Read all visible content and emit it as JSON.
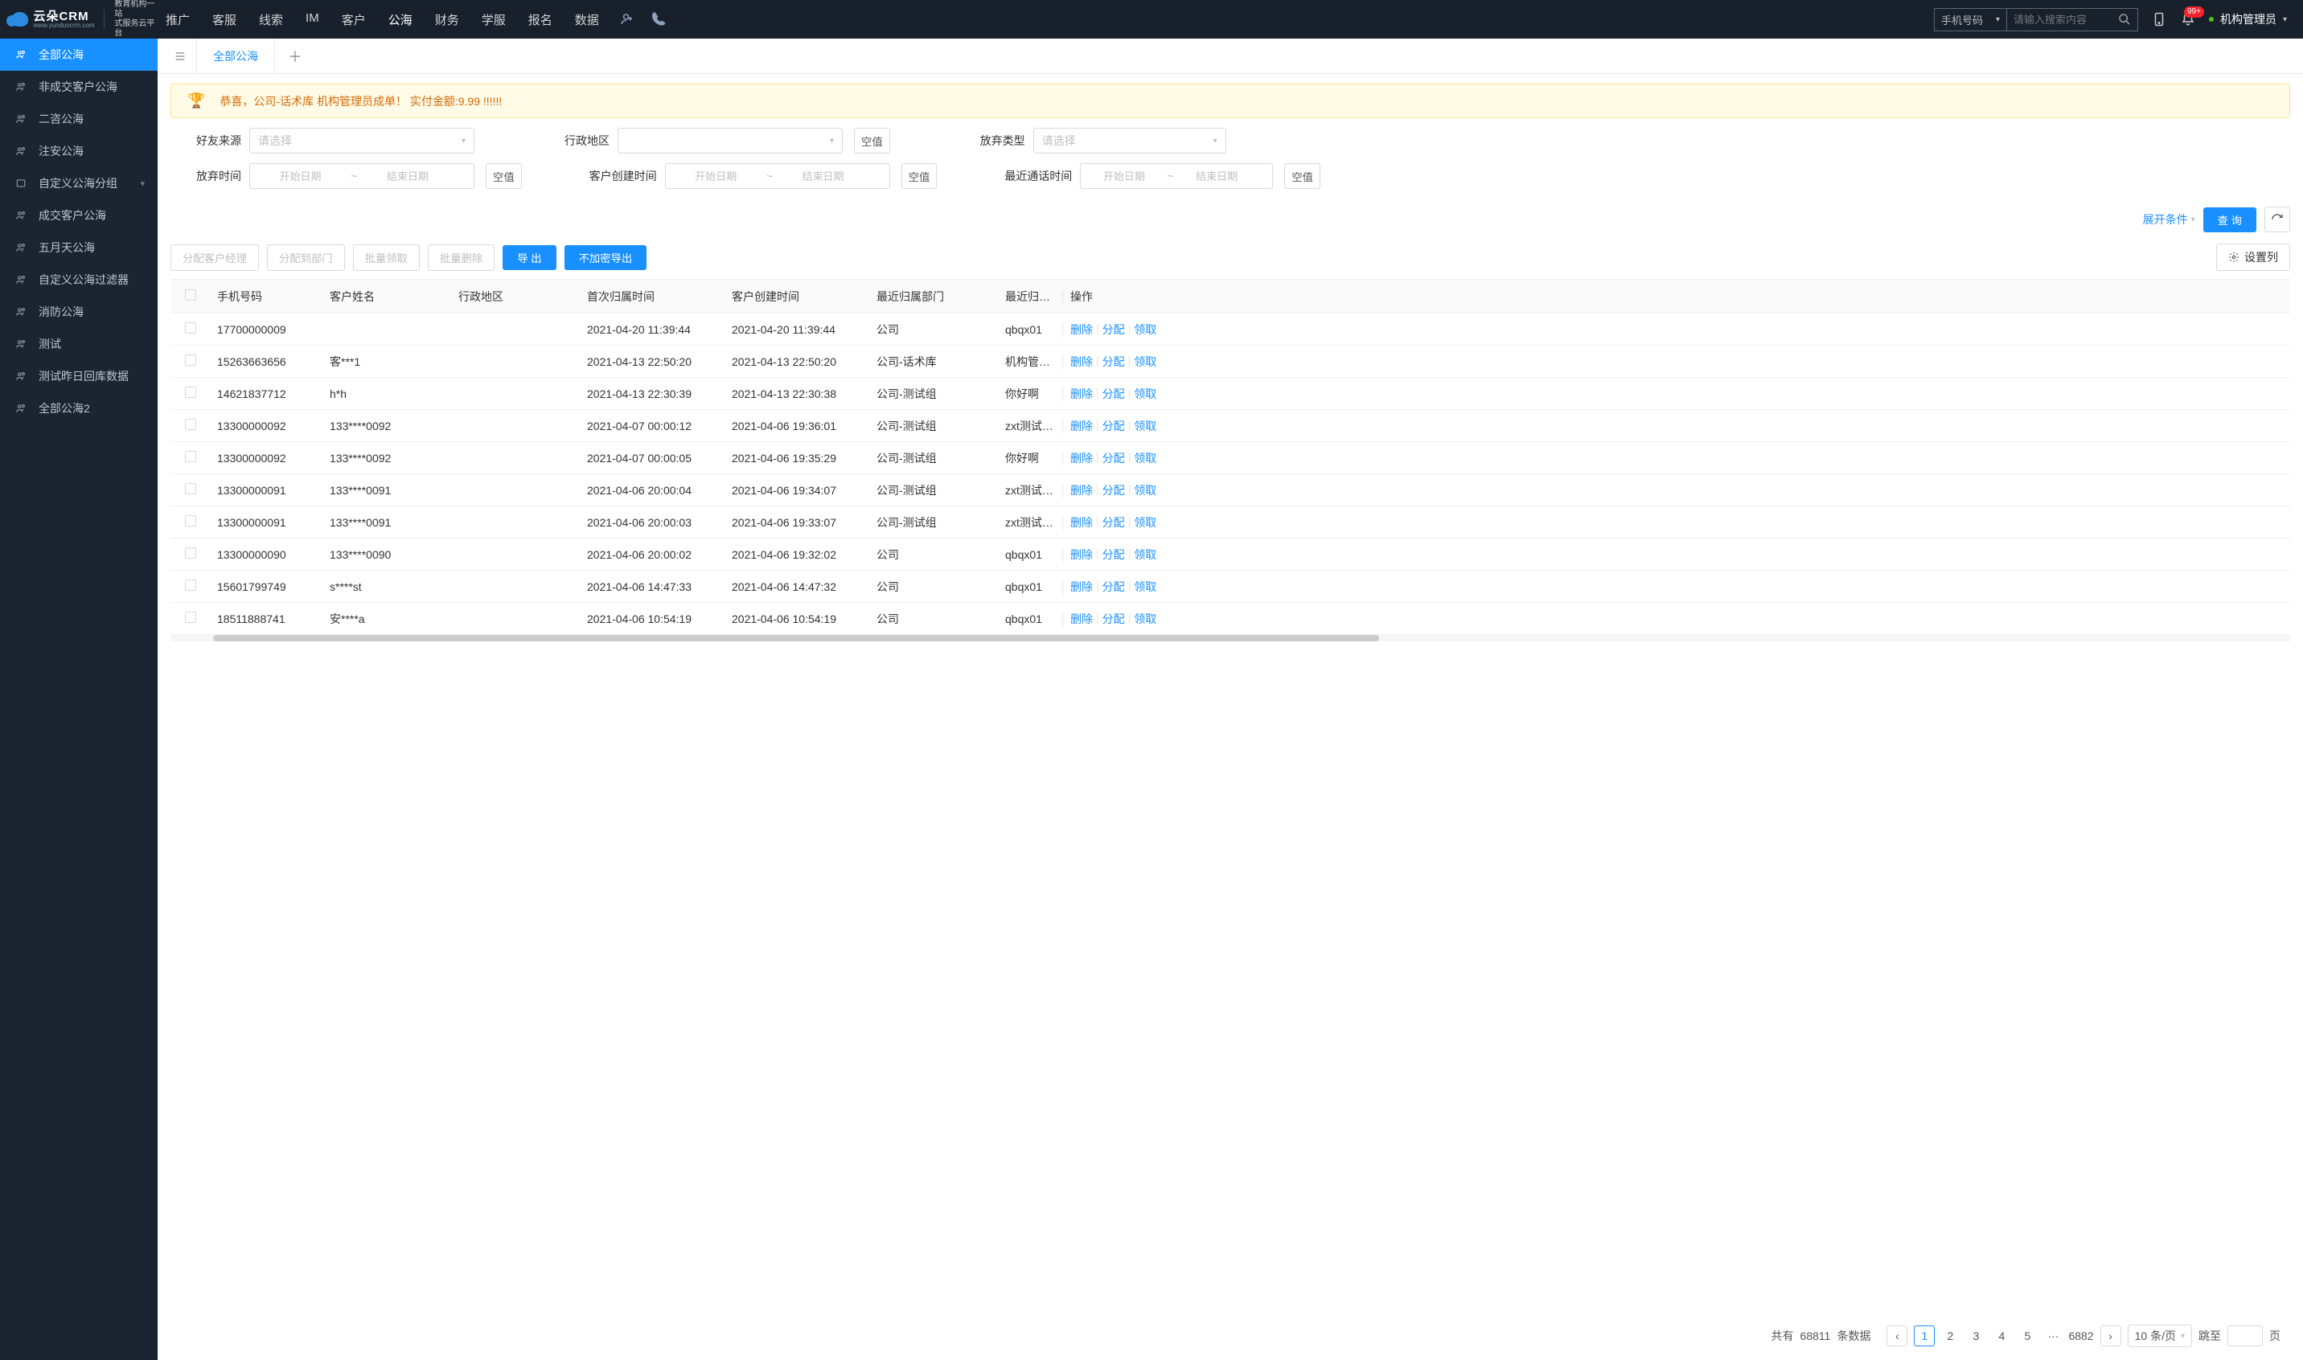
{
  "header": {
    "logo_main": "云朵CRM",
    "logo_sub": "www.yunduocrm.com",
    "logo_tag1": "教育机构一站",
    "logo_tag2": "式服务云平台",
    "nav": [
      "推广",
      "客服",
      "线索",
      "IM",
      "客户",
      "公海",
      "财务",
      "学服",
      "报名",
      "数据"
    ],
    "active_nav": "公海",
    "search_select": "手机号码",
    "search_placeholder": "请输入搜索内容",
    "notify_badge": "99+",
    "user_name": "机构管理员"
  },
  "sidebar": [
    {
      "label": "全部公海",
      "active": true,
      "chev": false
    },
    {
      "label": "非成交客户公海",
      "active": false,
      "chev": false
    },
    {
      "label": "二咨公海",
      "active": false,
      "chev": false
    },
    {
      "label": "注安公海",
      "active": false,
      "chev": false
    },
    {
      "label": "自定义公海分组",
      "active": false,
      "chev": true,
      "box": true
    },
    {
      "label": "成交客户公海",
      "active": false,
      "chev": false
    },
    {
      "label": "五月天公海",
      "active": false,
      "chev": false
    },
    {
      "label": "自定义公海过滤器",
      "active": false,
      "chev": false
    },
    {
      "label": "消防公海",
      "active": false,
      "chev": false
    },
    {
      "label": "测试",
      "active": false,
      "chev": false
    },
    {
      "label": "测试昨日回库数据",
      "active": false,
      "chev": false
    },
    {
      "label": "全部公海2",
      "active": false,
      "chev": false
    }
  ],
  "tab": {
    "label": "全部公海"
  },
  "alert": {
    "text": "恭喜，公司-话术库  机构管理员成单！  实付金额:9.99 !!!!!!"
  },
  "filters": {
    "placeholder_select": "请选择",
    "start_date": "开始日期",
    "end_date": "结束日期",
    "null_btn": "空值",
    "row1": [
      {
        "label": "好友来源",
        "type": "select"
      },
      {
        "label": "行政地区",
        "type": "select",
        "null": true,
        "empty": true
      },
      {
        "label": "放弃类型",
        "type": "select"
      }
    ],
    "row2": [
      {
        "label": "放弃时间",
        "type": "range",
        "null": true
      },
      {
        "label": "客户创建时间",
        "type": "range",
        "null": true
      },
      {
        "label": "最近通话时间",
        "type": "range",
        "null": true
      }
    ],
    "expand": "展开条件",
    "query": "查 询"
  },
  "toolbar": {
    "b1": "分配客户经理",
    "b2": "分配到部门",
    "b3": "批量领取",
    "b4": "批量删除",
    "b5": "导 出",
    "b6": "不加密导出",
    "settings": "设置列"
  },
  "table": {
    "headers": [
      "手机号码",
      "客户姓名",
      "行政地区",
      "首次归属时间",
      "客户创建时间",
      "最近归属部门",
      "最近归属人",
      "操作"
    ],
    "ops": [
      "删除",
      "分配",
      "领取"
    ],
    "rows": [
      {
        "phone": "17700000009",
        "name": "",
        "region": "",
        "first": "2021-04-20 11:39:44",
        "create": "2021-04-20 11:39:44",
        "dept": "公司",
        "owner": "qbqx01"
      },
      {
        "phone": "15263663656",
        "name": "客***1",
        "region": "",
        "first": "2021-04-13 22:50:20",
        "create": "2021-04-13 22:50:20",
        "dept": "公司-话术库",
        "owner": "机构管理员"
      },
      {
        "phone": "14621837712",
        "name": "h*h",
        "region": "",
        "first": "2021-04-13 22:30:39",
        "create": "2021-04-13 22:30:38",
        "dept": "公司-测试组",
        "owner": "你好啊"
      },
      {
        "phone": "13300000092",
        "name": "133****0092",
        "region": "",
        "first": "2021-04-07 00:00:12",
        "create": "2021-04-06 19:36:01",
        "dept": "公司-测试组",
        "owner": "zxt测试导入"
      },
      {
        "phone": "13300000092",
        "name": "133****0092",
        "region": "",
        "first": "2021-04-07 00:00:05",
        "create": "2021-04-06 19:35:29",
        "dept": "公司-测试组",
        "owner": "你好啊"
      },
      {
        "phone": "13300000091",
        "name": "133****0091",
        "region": "",
        "first": "2021-04-06 20:00:04",
        "create": "2021-04-06 19:34:07",
        "dept": "公司-测试组",
        "owner": "zxt测试导入"
      },
      {
        "phone": "13300000091",
        "name": "133****0091",
        "region": "",
        "first": "2021-04-06 20:00:03",
        "create": "2021-04-06 19:33:07",
        "dept": "公司-测试组",
        "owner": "zxt测试导入"
      },
      {
        "phone": "13300000090",
        "name": "133****0090",
        "region": "",
        "first": "2021-04-06 20:00:02",
        "create": "2021-04-06 19:32:02",
        "dept": "公司",
        "owner": "qbqx01"
      },
      {
        "phone": "15601799749",
        "name": "s****st",
        "region": "",
        "first": "2021-04-06 14:47:33",
        "create": "2021-04-06 14:47:32",
        "dept": "公司",
        "owner": "qbqx01"
      },
      {
        "phone": "18511888741",
        "name": "安****a",
        "region": "",
        "first": "2021-04-06 10:54:19",
        "create": "2021-04-06 10:54:19",
        "dept": "公司",
        "owner": "qbqx01"
      }
    ]
  },
  "pager": {
    "total_prefix": "共有",
    "total": "68811",
    "total_suffix": "条数据",
    "pages": [
      "1",
      "2",
      "3",
      "4",
      "5"
    ],
    "ellipsis": "···",
    "last": "6882",
    "size": "10 条/页",
    "jump_prefix": "跳至",
    "jump_suffix": "页"
  }
}
